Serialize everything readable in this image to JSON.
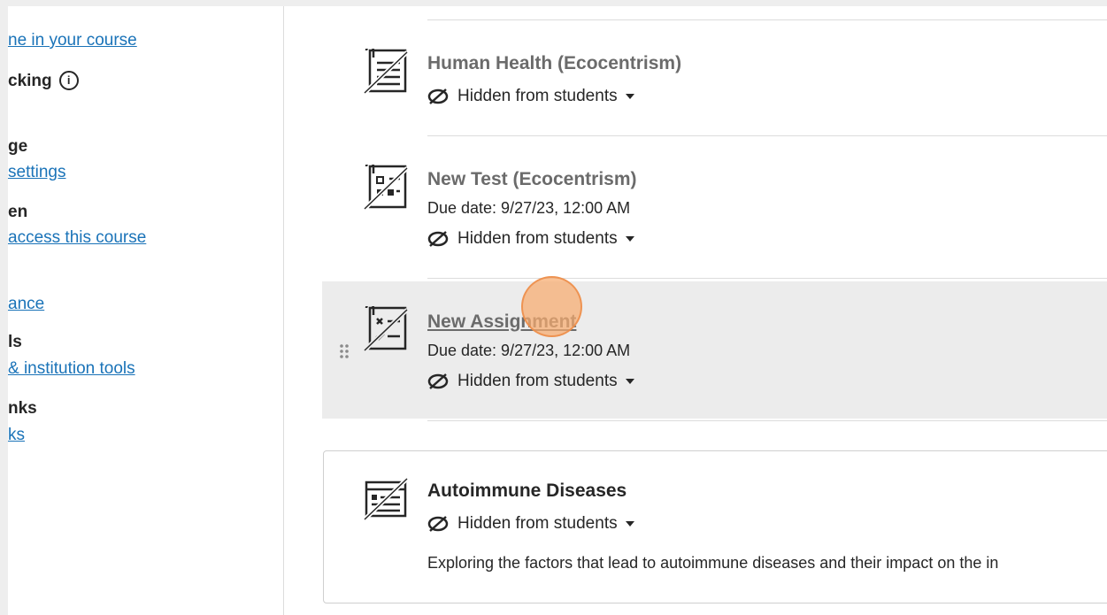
{
  "sidebar": {
    "link1": "ne in your course",
    "head1": "cking",
    "head2": "ge",
    "link2": "settings",
    "head3": "en",
    "link3": "access this course",
    "link4": "ance",
    "head4": "ls",
    "link5": "& institution tools",
    "head5": "nks",
    "link6": "ks"
  },
  "items": [
    {
      "title": "Human Health (Ecocentrism)",
      "visibility": "Hidden from students"
    },
    {
      "title": "New Test (Ecocentrism)",
      "due": "Due date: 9/27/23, 12:00 AM",
      "visibility": "Hidden from students"
    },
    {
      "title": "New Assignment",
      "due": "Due date: 9/27/23, 12:00 AM",
      "visibility": "Hidden from students"
    },
    {
      "title": "Autoimmune Diseases",
      "visibility": "Hidden from students",
      "description": "Exploring the factors that lead to autoimmune diseases and their impact on the in"
    }
  ],
  "colors": {
    "link": "#1a73b8",
    "highlight": "#ececec",
    "cursor": "#f6aa6e"
  }
}
